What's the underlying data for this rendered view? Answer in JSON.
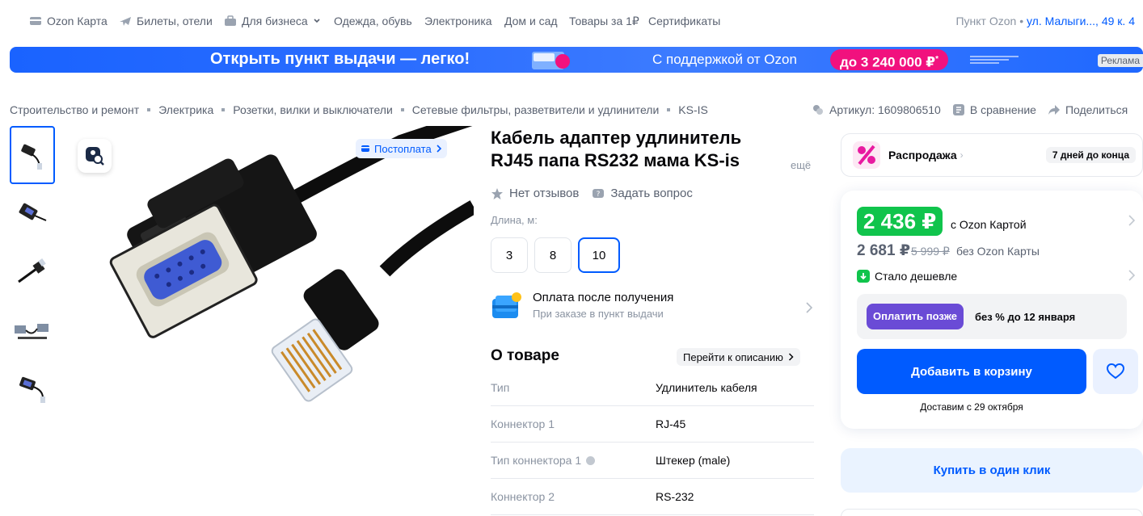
{
  "topnav": {
    "items": [
      {
        "label": "Ozon Карта",
        "icon": "card-icon"
      },
      {
        "label": "Билеты, отели",
        "icon": "plane-icon"
      },
      {
        "label": "Для бизнеса",
        "icon": "briefcase-icon"
      },
      {
        "label": "Одежда, обувь"
      },
      {
        "label": "Электроника"
      },
      {
        "label": "Дом и сад"
      },
      {
        "label": "Товары за 1₽"
      },
      {
        "label": "Сертификаты"
      }
    ],
    "pickup_label": "Пункт Ozon",
    "pickup_address": "ул. Малыги..., 49 к. 4"
  },
  "banner": {
    "headline": "Открыть пункт выдачи — легко!",
    "support": "С поддержкой от Ozon",
    "amount": "до 3 240 000 ₽",
    "amount_mark": "*",
    "ad_label": "Реклама"
  },
  "breadcrumbs": [
    "Строительство и ремонт",
    "Электрика",
    "Розетки, вилки и выключатели",
    "Сетевые фильтры, разветвители и удлинители",
    "KS-IS"
  ],
  "meta": {
    "article": "Артикул: 1609806510",
    "compare": "В сравнение",
    "share": "Поделиться"
  },
  "gallery": {
    "postpay": "Постоплата"
  },
  "product": {
    "title_line1": "Кабель адаптер удлинитель",
    "title_line2": "RJ45 папа RS232 мама KS-is",
    "more": "ещё",
    "reviews": "Нет отзывов",
    "ask": "Задать вопрос",
    "length_label": "Длина, м:",
    "length_options": [
      "3",
      "8",
      "10"
    ],
    "length_selected": "10",
    "pay_after_title": "Оплата после получения",
    "pay_after_sub": "При заказе в пункт выдачи",
    "about_title": "О товаре",
    "goto_desc": "Перейти к описанию",
    "specs": [
      {
        "key": "Тип",
        "value": "Удлинитель кабеля"
      },
      {
        "key": "Коннектор 1",
        "value": "RJ-45"
      },
      {
        "key": "Тип коннектора 1",
        "value": "Штекер (male)",
        "info": true
      },
      {
        "key": "Коннектор 2",
        "value": "RS-232"
      }
    ]
  },
  "buybox": {
    "sale_label": "Распродажа",
    "sale_days": "7 дней до конца",
    "price_ozon": "2 436 ₽",
    "with_card": "c Ozon Картой",
    "price_regular": "2 681 ₽",
    "price_old": "5 999 ₽",
    "without_card": "без Ozon Карты",
    "cheaper": "Стало дешевле",
    "pay_later_btn": "Оплатить позже",
    "pay_later_text": "без % до 12 января",
    "add_to_cart": "Добавить в корзину",
    "delivery": "Доставим с 29 октября",
    "one_click": "Купить в один клик"
  },
  "colors": {
    "accent": "#005bff",
    "price_green": "#10c44c",
    "sale_pink": "#f1117e",
    "pay_later_purple": "#6a4bd6"
  }
}
